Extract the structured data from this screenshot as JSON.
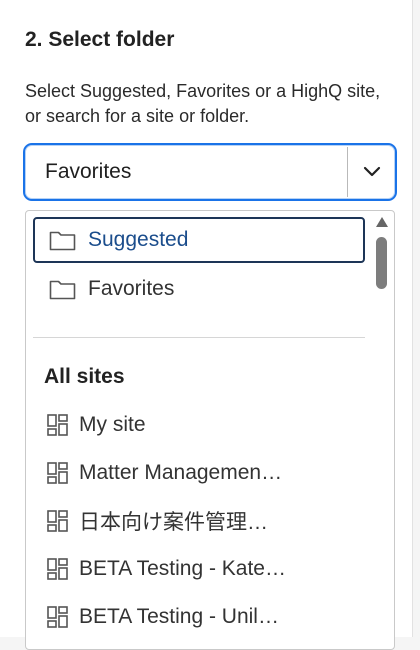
{
  "step": {
    "title": "2. Select folder",
    "helper": "Select Suggested, Favorites or a HighQ site, or search for a site or folder."
  },
  "select": {
    "value": "Favorites",
    "chevron_icon": "chevron-down-icon"
  },
  "dropdown": {
    "options": [
      {
        "label": "Suggested",
        "icon": "folder-icon",
        "active": true
      },
      {
        "label": "Favorites",
        "icon": "folder-icon",
        "active": false
      }
    ],
    "group_header": "All sites",
    "sites": [
      {
        "label": "My site",
        "icon": "site-grid-icon"
      },
      {
        "label": "Matter Managemen…",
        "icon": "site-grid-icon"
      },
      {
        "label": "日本向け案件管理…",
        "icon": "site-grid-icon"
      },
      {
        "label": "BETA Testing - Kate…",
        "icon": "site-grid-icon"
      },
      {
        "label": "BETA Testing - Unil…",
        "icon": "site-grid-icon"
      }
    ]
  },
  "colors": {
    "focus_border": "#1a73e8",
    "active_option_border": "#1d3557",
    "active_option_text": "#1b4d8c"
  }
}
